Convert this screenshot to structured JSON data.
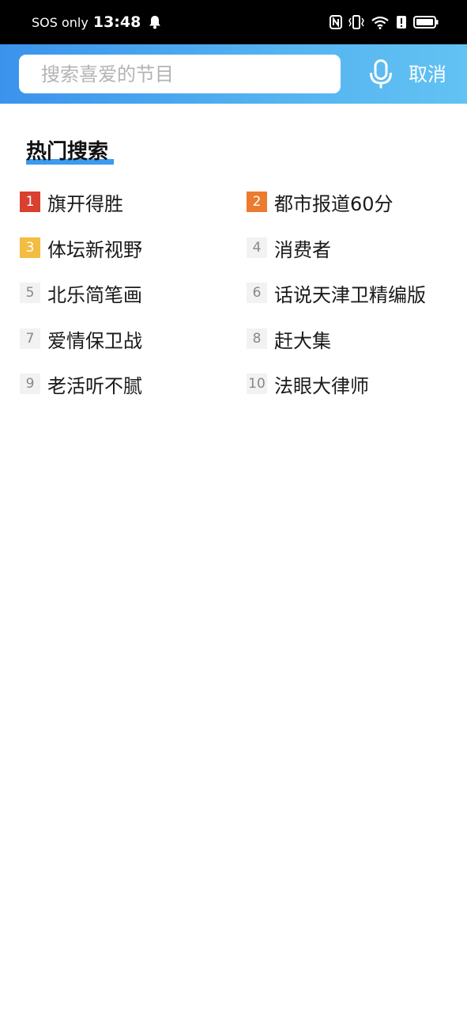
{
  "status_bar": {
    "carrier_text": "SOS only",
    "time": "13:48",
    "icons": [
      "bell-icon",
      "nfc-icon",
      "vibrate-icon",
      "wifi-icon",
      "alert-icon",
      "battery-icon"
    ]
  },
  "search": {
    "placeholder": "搜索喜爱的节目",
    "value": "",
    "mic_icon": "microphone-icon",
    "cancel_label": "取消"
  },
  "hot_search": {
    "title": "热门搜索",
    "items": [
      {
        "rank": "1",
        "label": "旗开得胜"
      },
      {
        "rank": "2",
        "label": "都市报道60分"
      },
      {
        "rank": "3",
        "label": "体坛新视野"
      },
      {
        "rank": "4",
        "label": "消费者"
      },
      {
        "rank": "5",
        "label": "北乐简笔画"
      },
      {
        "rank": "6",
        "label": "话说天津卫精编版"
      },
      {
        "rank": "7",
        "label": "爱情保卫战"
      },
      {
        "rank": "8",
        "label": "赶大集"
      },
      {
        "rank": "9",
        "label": "老活听不腻"
      },
      {
        "rank": "10",
        "label": "法眼大律师"
      }
    ]
  },
  "colors": {
    "header_gradient_start": "#3b93ec",
    "header_gradient_end": "#62c2f2",
    "rank1": "#d9402f",
    "rank2": "#eb7b2f",
    "rank3": "#f3bd42",
    "title_underline": "#3a9bf0"
  }
}
